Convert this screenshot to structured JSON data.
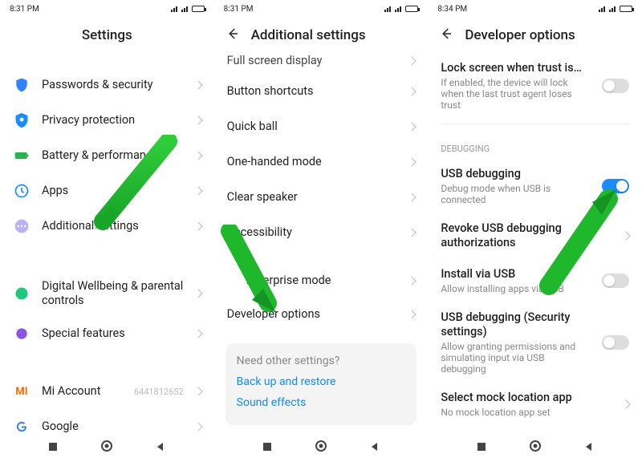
{
  "phone1": {
    "time": "8:31 PM",
    "title": "Settings",
    "rows": [
      {
        "icon": "shield",
        "label": "Passwords & security"
      },
      {
        "icon": "privacy",
        "label": "Privacy protection"
      },
      {
        "icon": "battery",
        "label": "Battery & performance"
      },
      {
        "icon": "apps",
        "label": "Apps"
      },
      {
        "icon": "additional",
        "label": "Additional settings"
      }
    ],
    "rows2": [
      {
        "icon": "wellbeing",
        "label": "Digital Wellbeing & parental controls"
      },
      {
        "icon": "special",
        "label": "Special features"
      }
    ],
    "rows3": [
      {
        "icon": "mi",
        "label": "Mi Account",
        "value": "6441812652"
      },
      {
        "icon": "google",
        "label": "Google"
      }
    ]
  },
  "phone2": {
    "time": "8:31 PM",
    "title": "Additional settings",
    "rows": [
      {
        "label": "Full screen display",
        "cut": true
      },
      {
        "label": "Button shortcuts"
      },
      {
        "label": "Quick ball"
      },
      {
        "label": "One-handed mode"
      },
      {
        "label": "Clear speaker"
      },
      {
        "label": "Accessibility"
      }
    ],
    "rows2": [
      {
        "label": "Enterprise mode",
        "cut": true
      },
      {
        "label": "Developer options"
      }
    ],
    "card": {
      "head": "Need other settings?",
      "link1": "Back up and restore",
      "link2": "Sound effects"
    }
  },
  "phone3": {
    "time": "8:34 PM",
    "title": "Developer options",
    "topItem": {
      "title": "Lock screen when trust is…",
      "sub": "If enabled, the device will lock when the last trust agent loses trust",
      "on": false
    },
    "sectionHead": "DEBUGGING",
    "rows": [
      {
        "title": "USB debugging",
        "sub": "Debug mode when USB is connected",
        "type": "toggle",
        "on": true
      },
      {
        "title": "Revoke USB debugging authorizations",
        "type": "chev"
      },
      {
        "title": "Install via USB",
        "sub": "Allow installing apps via USB",
        "type": "toggle",
        "on": false
      },
      {
        "title": "USB debugging (Security settings)",
        "sub": "Allow granting permissions and simulating input via USB debugging",
        "type": "toggle",
        "on": false
      },
      {
        "title": "Select mock location app",
        "sub": "No mock location app set",
        "type": "chev"
      }
    ]
  }
}
